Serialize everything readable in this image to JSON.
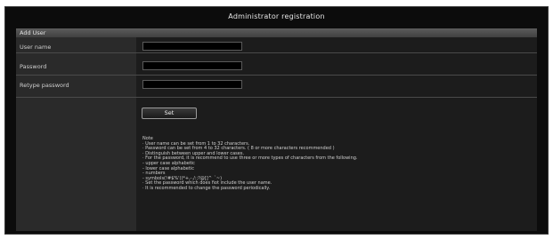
{
  "window": {
    "title": "Administrator registration"
  },
  "section": {
    "title": "Add User"
  },
  "fields": [
    {
      "label": "User name",
      "value": ""
    },
    {
      "label": "Password",
      "value": ""
    },
    {
      "label": "Retype password",
      "value": ""
    }
  ],
  "set_button": {
    "label": "Set"
  },
  "note": {
    "title": "Note",
    "lines": [
      "· User name can be set from 1 to 32 characters.",
      "· Password can be set from 4 to 32 characters. ( 8 or more characters recommended )",
      "· Distinguish between upper and lower cases.",
      "· For the password, it is recommend to use three or more types of characters from the following.",
      "  - upper case alphabetic",
      "  - lower case alphabetic",
      "  - numbers",
      "  - symbols(!#$%'()*+,-./:;?@[]^_`~)",
      "· Set the password which does not include the user name.",
      "· It is recommended to change the password periodically."
    ]
  }
}
